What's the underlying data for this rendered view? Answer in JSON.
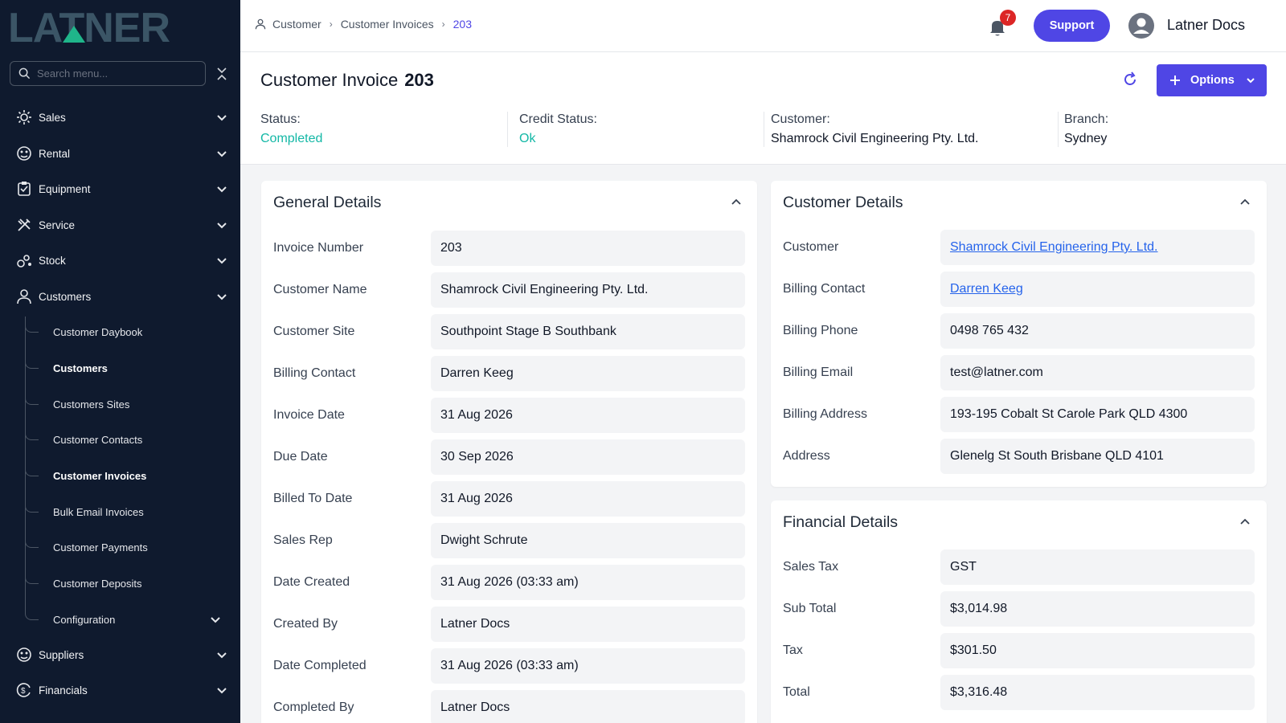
{
  "brand": {
    "logo_text": "LATNER",
    "accent": "#4f46e5",
    "teal": "#14b8a6"
  },
  "sidebar": {
    "search_placeholder": "Search menu...",
    "items": [
      {
        "label": "Sales",
        "icon": "sales-icon"
      },
      {
        "label": "Rental",
        "icon": "rental-icon"
      },
      {
        "label": "Equipment",
        "icon": "equipment-icon"
      },
      {
        "label": "Service",
        "icon": "service-icon"
      },
      {
        "label": "Stock",
        "icon": "stock-icon"
      },
      {
        "label": "Customers",
        "icon": "user-icon"
      }
    ],
    "sub_items": [
      {
        "label": "Customer Daybook"
      },
      {
        "label": "Customers",
        "active": true
      },
      {
        "label": "Customers Sites"
      },
      {
        "label": "Customer Contacts"
      },
      {
        "label": "Customer Invoices",
        "active": true
      },
      {
        "label": "Bulk Email Invoices"
      },
      {
        "label": "Customer Payments"
      },
      {
        "label": "Customer Deposits"
      },
      {
        "label": "Configuration"
      }
    ],
    "bottom_items": [
      {
        "label": "Suppliers",
        "icon": "suppliers-icon"
      },
      {
        "label": "Financials",
        "icon": "financials-icon"
      }
    ]
  },
  "topbar": {
    "breadcrumb": [
      "Customer",
      "Customer Invoices",
      "203"
    ],
    "notifications": "7",
    "support_label": "Support",
    "user_name": "Latner Docs"
  },
  "header": {
    "title": "Customer Invoice",
    "number": "203",
    "options_label": "Options",
    "stats": [
      {
        "label": "Status:",
        "value": "Completed",
        "green": true
      },
      {
        "label": "Credit Status:",
        "value": "Ok",
        "green": true
      },
      {
        "label": "Customer:",
        "value": "Shamrock Civil Engineering Pty. Ltd."
      },
      {
        "label": "Branch:",
        "value": "Sydney"
      }
    ]
  },
  "general": {
    "title": "General Details",
    "rows": [
      {
        "label": "Invoice Number",
        "value": "203"
      },
      {
        "label": "Customer Name",
        "value": "Shamrock Civil Engineering Pty. Ltd."
      },
      {
        "label": "Customer Site",
        "value": "Southpoint Stage B Southbank"
      },
      {
        "label": "Billing Contact",
        "value": "Darren Keeg"
      },
      {
        "label": "Invoice Date",
        "value": "31 Aug 2026"
      },
      {
        "label": "Due Date",
        "value": "30 Sep 2026"
      },
      {
        "label": "Billed To Date",
        "value": "31 Aug 2026"
      },
      {
        "label": "Sales Rep",
        "value": "Dwight Schrute"
      },
      {
        "label": "Date Created",
        "value": "31 Aug 2026 (03:33 am)"
      },
      {
        "label": "Created By",
        "value": "Latner Docs"
      },
      {
        "label": "Date Completed",
        "value": "31 Aug 2026 (03:33 am)"
      },
      {
        "label": "Completed By",
        "value": "Latner Docs"
      }
    ]
  },
  "customer": {
    "title": "Customer Details",
    "rows": [
      {
        "label": "Customer",
        "value": "Shamrock Civil Engineering Pty. Ltd.",
        "link": true
      },
      {
        "label": "Billing Contact",
        "value": "Darren Keeg",
        "link": true
      },
      {
        "label": "Billing Phone",
        "value": "0498 765 432"
      },
      {
        "label": "Billing Email",
        "value": "test@latner.com"
      },
      {
        "label": "Billing Address",
        "value": "193-195 Cobalt St Carole Park QLD 4300"
      },
      {
        "label": "Address",
        "value": "Glenelg St South Brisbane QLD 4101"
      }
    ]
  },
  "financial": {
    "title": "Financial Details",
    "rows": [
      {
        "label": "Sales Tax",
        "value": "GST"
      },
      {
        "label": "Sub Total",
        "value": "$3,014.98"
      },
      {
        "label": "Tax",
        "value": "$301.50"
      },
      {
        "label": "Total",
        "value": "$3,316.48"
      }
    ]
  }
}
